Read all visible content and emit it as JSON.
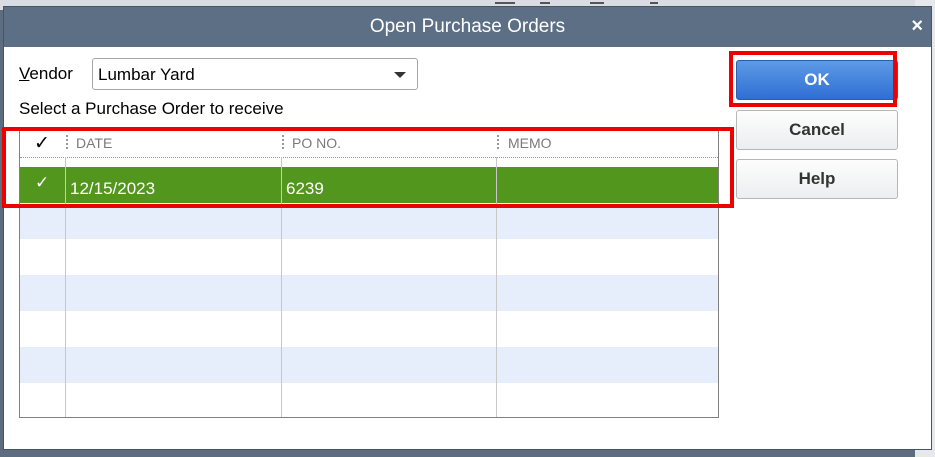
{
  "dialog": {
    "title": "Open Purchase Orders",
    "close_glyph": "×"
  },
  "vendor": {
    "label_underlined": "V",
    "label_rest": "endor",
    "value": "Lumbar Yard"
  },
  "instruction": "Select a Purchase Order to receive",
  "grid": {
    "columns": {
      "check": "✓",
      "date": "DATE",
      "po_no": "PO NO.",
      "memo": "MEMO"
    },
    "rows": [
      {
        "checked": "✓",
        "date": "12/15/2023",
        "po_no": "6239",
        "memo": ""
      }
    ]
  },
  "buttons": {
    "ok": "OK",
    "cancel": "Cancel",
    "help": "Help"
  },
  "colors": {
    "selected_row": "#52961e",
    "alt_row": "#e5eefa",
    "title_bar": "#5d6f85",
    "ok_button": "#2f6fd3",
    "highlight": "#ee0000"
  }
}
